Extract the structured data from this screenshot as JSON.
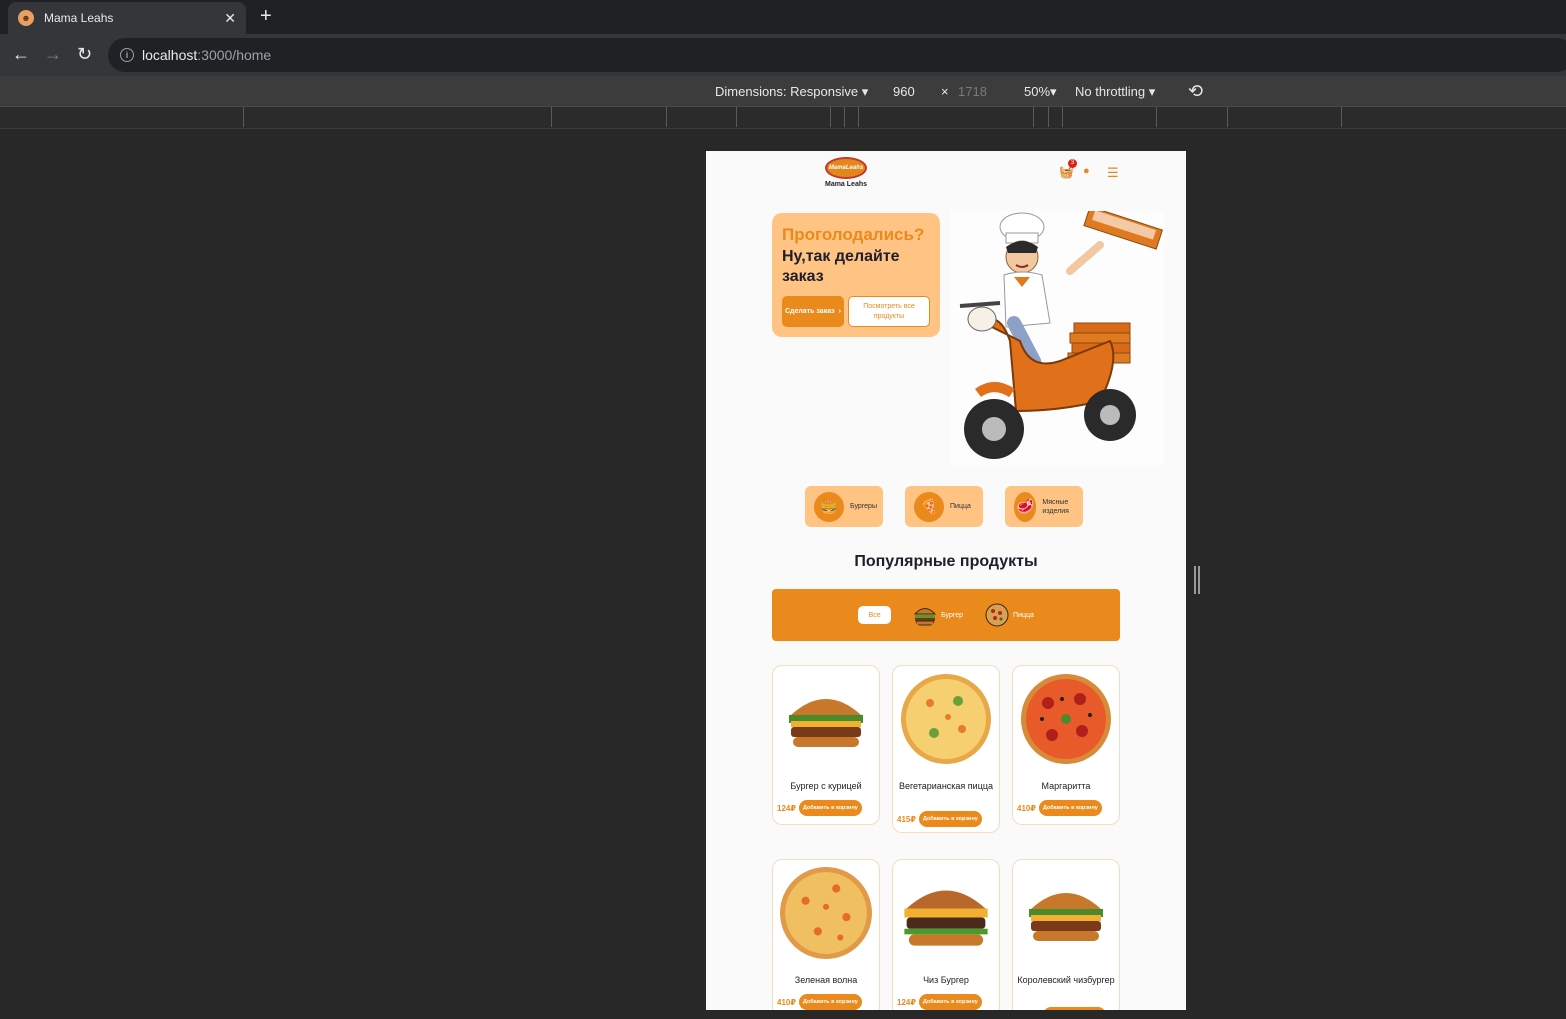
{
  "browser": {
    "tab_title": "Mama Leahs",
    "url_host": "localhost",
    "url_path": ":3000/home"
  },
  "devtools": {
    "dimensions_label": "Dimensions: Responsive",
    "width": "960",
    "times": "×",
    "height": "1718",
    "zoom": "50%",
    "throttling": "No throttling"
  },
  "site": {
    "logo_text": "Mama Leahs",
    "logo_badge": "MamaLeahs",
    "cart_count": "3",
    "hero": {
      "question": "Проголодались?",
      "subtitle": "Ну,так делайте заказ",
      "order_button": "Сделать заказ",
      "all_products_button": "Посмотреть все продукты"
    },
    "categories": [
      {
        "label": "Бургеры",
        "icon": "burger-icon"
      },
      {
        "label": "Пицца",
        "icon": "pizza-icon"
      },
      {
        "label": "Мясные изделия",
        "icon": "meat-icon"
      }
    ],
    "popular_title": "Популярные продукты",
    "filters": {
      "all": "Все",
      "burger": "Бургер",
      "pizza": "Пицца"
    },
    "add_label": "Добавить в корзину",
    "products": [
      {
        "name": "Бургер с курицей",
        "price": "124₽",
        "kind": "burger"
      },
      {
        "name": "Вегетарианская пицца",
        "price": "415₽",
        "kind": "pizza"
      },
      {
        "name": "Маргаритта",
        "price": "410₽",
        "kind": "pizza"
      },
      {
        "name": "Зеленая волна",
        "price": "410₽",
        "kind": "pizza"
      },
      {
        "name": "Чиз Бургер",
        "price": "124₽",
        "kind": "burger"
      },
      {
        "name": "Королевский чизбургер",
        "price": "",
        "kind": "burger"
      }
    ]
  }
}
